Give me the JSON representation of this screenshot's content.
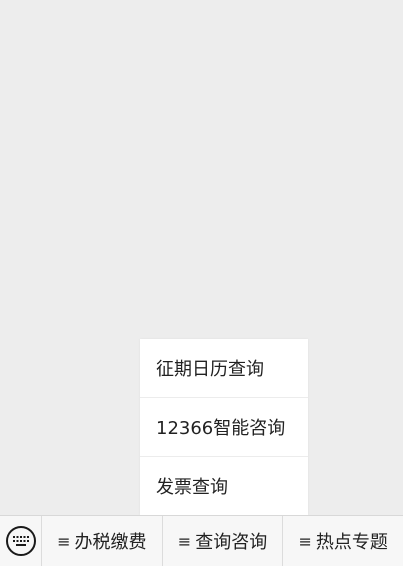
{
  "popup_menu": {
    "items": [
      {
        "label": "征期日历查询"
      },
      {
        "label": "12366智能咨询"
      },
      {
        "label": "发票查询"
      }
    ]
  },
  "menubar": {
    "keyboard_icon": "keyboard-icon",
    "menu_icon": "hamburger-icon",
    "menu_icon_glyph": "≡",
    "tabs": [
      {
        "label": "办税缴费"
      },
      {
        "label": "查询咨询"
      },
      {
        "label": "热点专题"
      }
    ]
  }
}
